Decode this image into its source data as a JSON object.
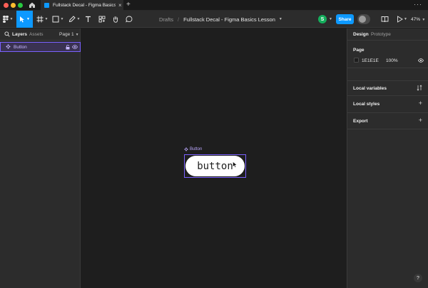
{
  "tab": {
    "title": "Fullstack Decal - Figma Basics Lesson",
    "close": "×"
  },
  "new_tab": "+",
  "more": "···",
  "breadcrumb": {
    "drafts": "Drafts",
    "separator": "/",
    "file": "Fullstack Decal - Figma Basics Lesson"
  },
  "user": {
    "avatar_initial": "S",
    "avatar_color": "#14ae5c"
  },
  "share_label": "Share",
  "zoom_label": "47%",
  "accent": "#0d99ff",
  "left_panel": {
    "tabs": {
      "layers": "Layers",
      "assets": "Assets"
    },
    "page_selector": "Page 1",
    "layers": [
      {
        "name": "Button",
        "type": "component"
      }
    ]
  },
  "canvas": {
    "background": "#1e1e1e",
    "frame_label": "Button",
    "button_text": "button"
  },
  "right_panel": {
    "tabs": {
      "design": "Design",
      "prototype": "Prototype"
    },
    "page": {
      "title": "Page",
      "color_hex": "1E1E1E",
      "opacity": "100%"
    },
    "sections": {
      "local_variables": "Local variables",
      "local_styles": "Local styles",
      "export": "Export"
    }
  },
  "help_label": "?"
}
